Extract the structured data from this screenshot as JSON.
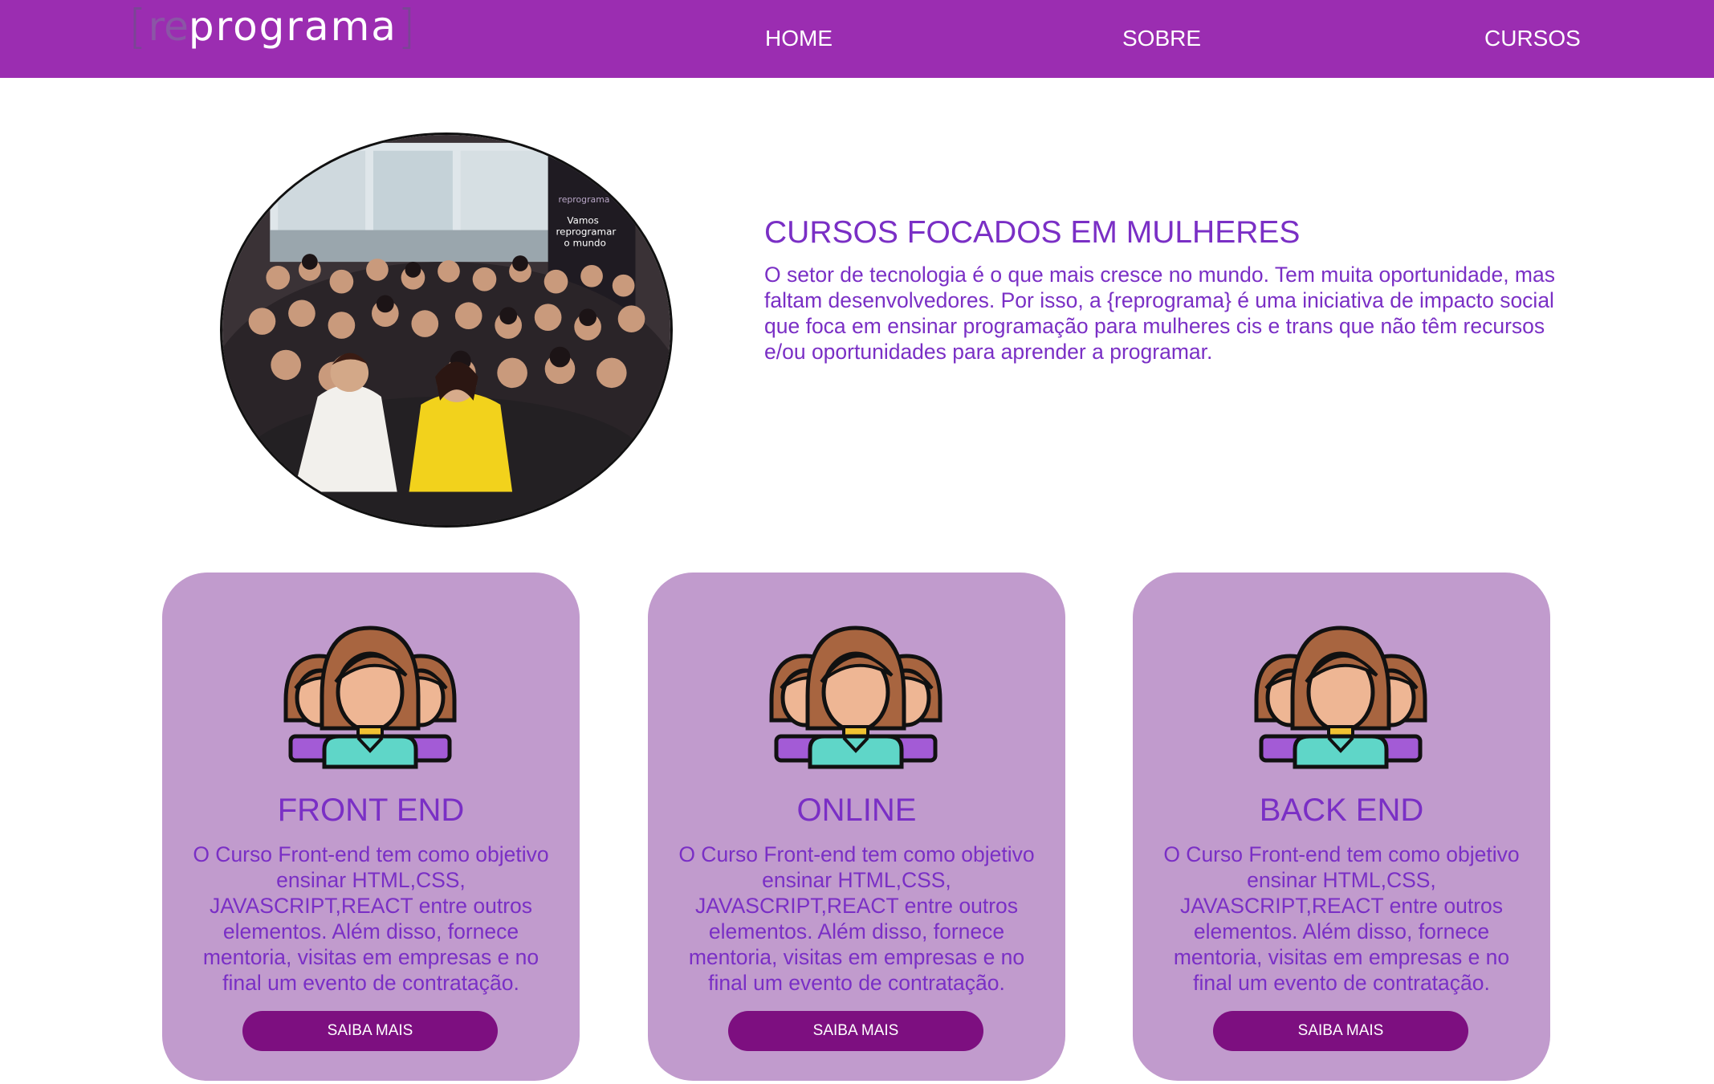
{
  "header": {
    "logo": {
      "bracket_open": "[",
      "prefix": "re",
      "word": "programa",
      "bracket_close": "]"
    },
    "nav": [
      {
        "label": "HOME"
      },
      {
        "label": "SOBRE"
      },
      {
        "label": "CURSOS"
      }
    ]
  },
  "hero": {
    "title": "CURSOS FOCADOS EM MULHERES",
    "body": "O setor de tecnologia é o que mais cresce no mundo. Tem muita oportunidade, mas faltam desenvolvedores. Por isso, a {reprograma} é uma iniciativa de impacto social que foca em ensinar programação para mulheres cis e trans que não têm recursos e/ou oportunidades para aprender a programar.",
    "photo_sign": {
      "brand": "reprograma",
      "line1": "Vamos",
      "line2": "reprogramar",
      "line3": "o mundo"
    }
  },
  "cards": [
    {
      "icon": "women-group-icon",
      "title": "FRONT END",
      "description": "O Curso Front-end tem como objetivo ensinar HTML,CSS, JAVASCRIPT,REACT entre outros elementos. Além disso, fornece mentoria, visitas em empresas e no final um evento de contratação.",
      "button": "SAIBA MAIS"
    },
    {
      "icon": "women-group-icon",
      "title": "ONLINE",
      "description": "O Curso Front-end tem como objetivo ensinar HTML,CSS, JAVASCRIPT,REACT entre outros elementos. Além disso, fornece mentoria, visitas em empresas e no final um evento de contratação.",
      "button": "SAIBA MAIS"
    },
    {
      "icon": "women-group-icon",
      "title": "BACK END",
      "description": "O Curso Front-end tem como objetivo ensinar HTML,CSS, JAVASCRIPT,REACT entre outros elementos. Além disso, fornece mentoria, visitas em empresas e no final um evento de contratação.",
      "button": "SAIBA MAIS"
    }
  ],
  "colors": {
    "header_bg": "#9b2db1",
    "accent_text": "#7a2fc5",
    "card_bg": "#c19bcd",
    "button_bg": "#7d0f80"
  }
}
